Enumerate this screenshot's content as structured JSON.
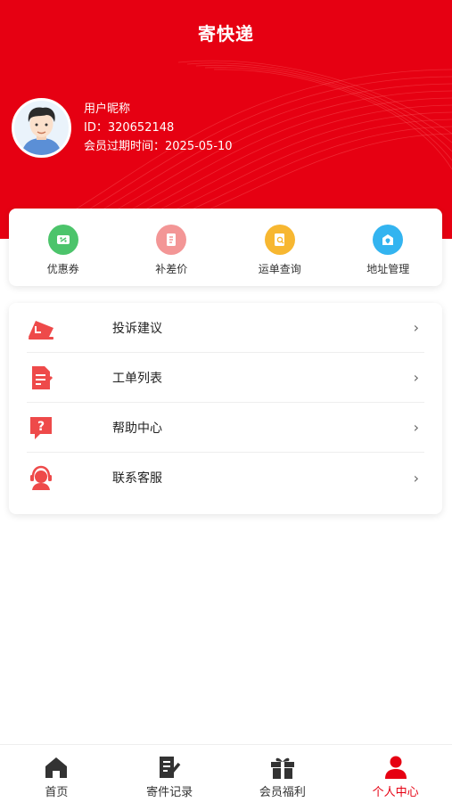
{
  "app": {
    "title": "寄快递"
  },
  "user": {
    "nickname": "用户昵称",
    "id_text": "ID：320652148",
    "expire_text": "会员过期时间：2025-05-10"
  },
  "quick_actions": [
    {
      "label": "优惠券",
      "icon": "coupon-icon",
      "color": "#4cc46b"
    },
    {
      "label": "补差价",
      "icon": "price-difference-icon",
      "color": "#f39696"
    },
    {
      "label": "运单查询",
      "icon": "waybill-search-icon",
      "color": "#f7b731"
    },
    {
      "label": "地址管理",
      "icon": "address-icon",
      "color": "#33b4f0"
    }
  ],
  "menu": [
    {
      "label": "投诉建议",
      "icon": "complaint-icon"
    },
    {
      "label": "工单列表",
      "icon": "ticket-list-icon"
    },
    {
      "label": "帮助中心",
      "icon": "help-icon"
    },
    {
      "label": "联系客服",
      "icon": "customer-service-icon"
    }
  ],
  "tabs": [
    {
      "label": "首页",
      "icon": "home-icon",
      "active": false
    },
    {
      "label": "寄件记录",
      "icon": "shipping-record-icon",
      "active": false
    },
    {
      "label": "会员福利",
      "icon": "gift-icon",
      "active": false
    },
    {
      "label": "个人中心",
      "icon": "person-icon",
      "active": true
    }
  ],
  "colors": {
    "brand": "#e60012",
    "menu_icon": "#ee4a4a"
  }
}
